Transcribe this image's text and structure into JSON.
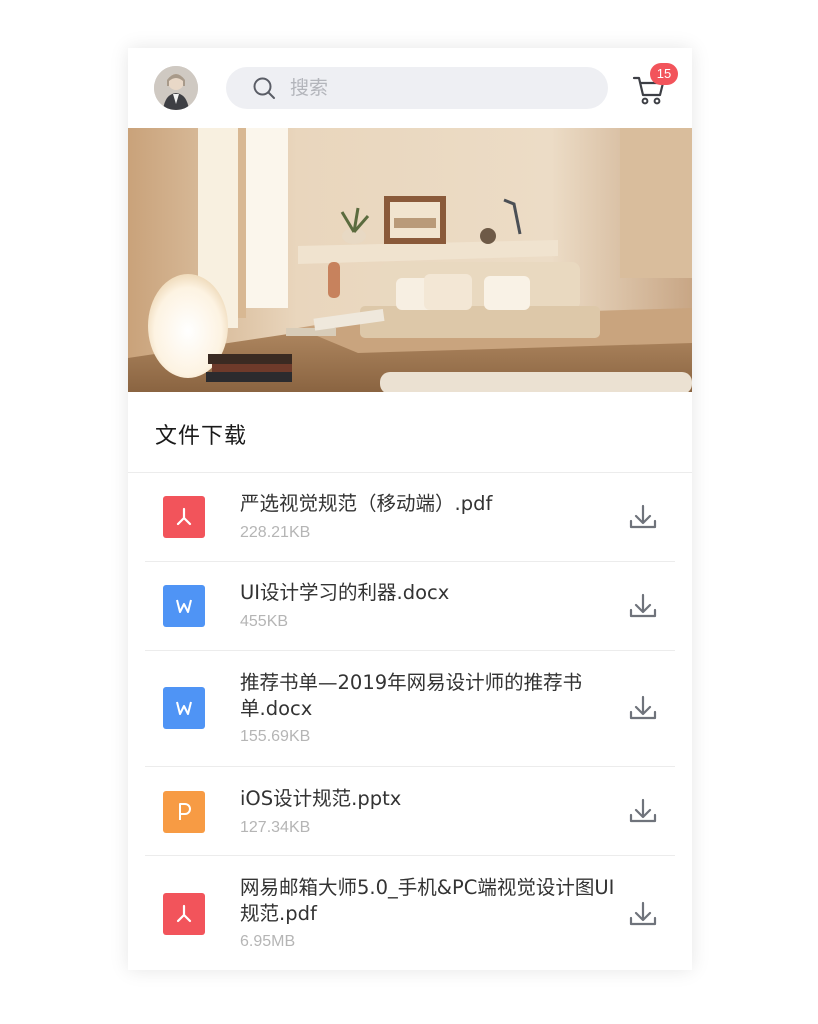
{
  "header": {
    "search_placeholder": "搜索",
    "cart_badge": "15",
    "accent_color": "#f2545b"
  },
  "section": {
    "title": "文件下载"
  },
  "files": [
    {
      "name": "严选视觉规范（移动端）.pdf",
      "size": "228.21KB",
      "type": "pdf",
      "icon": "pdf-icon",
      "color": "#f2545b"
    },
    {
      "name": "UI设计学习的利器.docx",
      "size": "455KB",
      "type": "word",
      "icon": "word-icon",
      "color": "#4f94f5"
    },
    {
      "name": "推荐书单—2019年网易设计师的推荐书单.docx",
      "size": "155.69KB",
      "type": "word",
      "icon": "word-icon",
      "color": "#4f94f5"
    },
    {
      "name": "iOS设计规范.pptx",
      "size": "127.34KB",
      "type": "ppt",
      "icon": "ppt-icon",
      "color": "#f79b44"
    },
    {
      "name": "网易邮箱大师5.0_手机&PC端视觉设计图UI规范.pdf",
      "size": "6.95MB",
      "type": "pdf",
      "icon": "pdf-icon",
      "color": "#f2545b"
    }
  ]
}
